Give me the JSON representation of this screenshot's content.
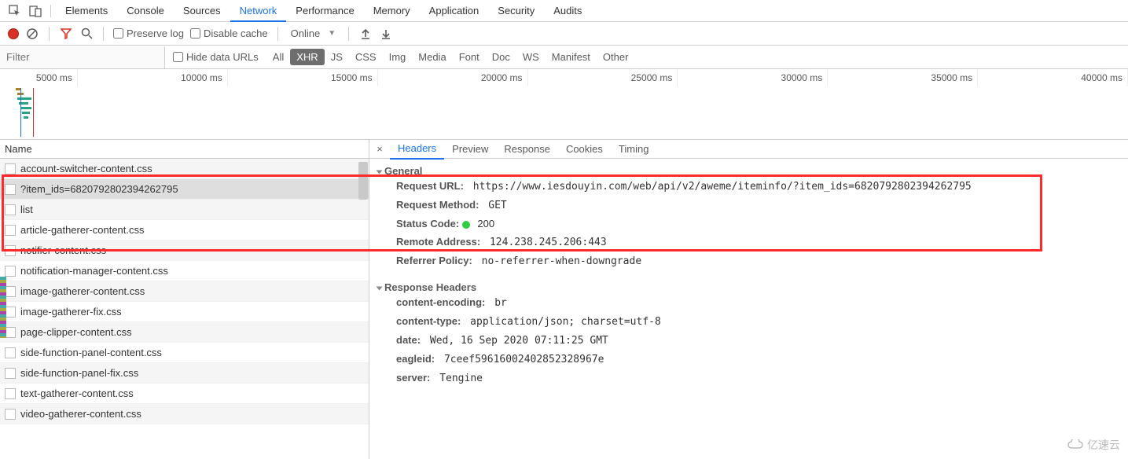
{
  "top_tabs": {
    "items": [
      "Elements",
      "Console",
      "Sources",
      "Network",
      "Performance",
      "Memory",
      "Application",
      "Security",
      "Audits"
    ],
    "active": "Network"
  },
  "toolbar": {
    "preserve_log": "Preserve log",
    "disable_cache": "Disable cache",
    "online": "Online"
  },
  "filter": {
    "placeholder": "Filter",
    "hide_data_urls": "Hide data URLs",
    "types": [
      "All",
      "XHR",
      "JS",
      "CSS",
      "Img",
      "Media",
      "Font",
      "Doc",
      "WS",
      "Manifest",
      "Other"
    ],
    "active_type": "XHR"
  },
  "timeline": {
    "ticks": [
      "5000 ms",
      "10000 ms",
      "15000 ms",
      "20000 ms",
      "25000 ms",
      "30000 ms",
      "35000 ms",
      "40000 ms"
    ]
  },
  "split": {
    "name_header": "Name",
    "detail_tabs": [
      "Headers",
      "Preview",
      "Response",
      "Cookies",
      "Timing"
    ],
    "active_detail_tab": "Headers"
  },
  "requests": [
    {
      "name": "account-switcher-content.css"
    },
    {
      "name": "?item_ids=6820792802394262795",
      "selected": true
    },
    {
      "name": "list"
    },
    {
      "name": "article-gatherer-content.css"
    },
    {
      "name": "notifier-content.css"
    },
    {
      "name": "notification-manager-content.css"
    },
    {
      "name": "image-gatherer-content.css"
    },
    {
      "name": "image-gatherer-fix.css"
    },
    {
      "name": "page-clipper-content.css"
    },
    {
      "name": "side-function-panel-content.css"
    },
    {
      "name": "side-function-panel-fix.css"
    },
    {
      "name": "text-gatherer-content.css"
    },
    {
      "name": "video-gatherer-content.css"
    }
  ],
  "details": {
    "general_title": "General",
    "general": [
      {
        "k": "Request URL:",
        "v": "https://www.iesdouyin.com/web/api/v2/aweme/iteminfo/?item_ids=6820792802394262795",
        "mono": true
      },
      {
        "k": "Request Method:",
        "v": "GET",
        "mono": true
      },
      {
        "k": "Status Code:",
        "v": "200",
        "status": true
      },
      {
        "k": "Remote Address:",
        "v": "124.238.245.206:443",
        "mono": true
      },
      {
        "k": "Referrer Policy:",
        "v": "no-referrer-when-downgrade",
        "mono": true
      }
    ],
    "response_headers_title": "Response Headers",
    "response_headers": [
      {
        "k": "content-encoding:",
        "v": "br",
        "mono": true
      },
      {
        "k": "content-type:",
        "v": "application/json; charset=utf-8",
        "mono": true
      },
      {
        "k": "date:",
        "v": "Wed, 16 Sep 2020 07:11:25 GMT",
        "mono": true
      },
      {
        "k": "eagleid:",
        "v": "7ceef59616002402852328967e",
        "mono": true
      },
      {
        "k": "server:",
        "v": "Tengine",
        "mono": true
      }
    ]
  },
  "watermark": "亿速云"
}
